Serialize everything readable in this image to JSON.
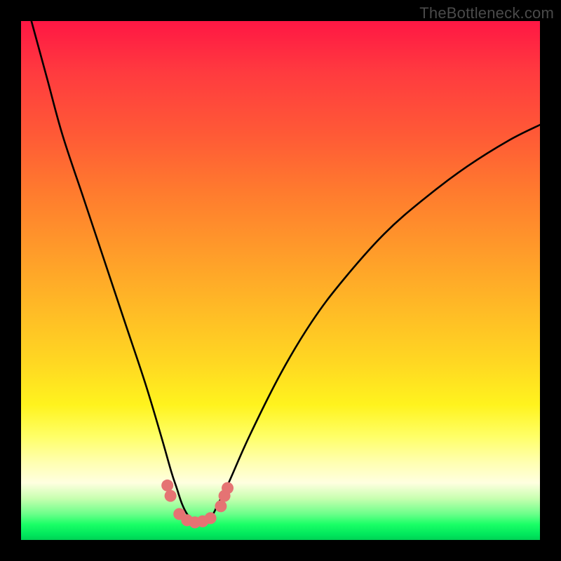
{
  "watermark": "TheBottleneck.com",
  "chart_data": {
    "type": "line",
    "title": "",
    "xlabel": "",
    "ylabel": "",
    "xlim": [
      0,
      100
    ],
    "ylim": [
      0,
      100
    ],
    "series": [
      {
        "name": "bottleneck-curve",
        "x": [
          2,
          5,
          8,
          12,
          16,
          20,
          24,
          27,
          29,
          30,
          31,
          32,
          33,
          34,
          35,
          36,
          37,
          38,
          40,
          44,
          50,
          56,
          62,
          70,
          78,
          86,
          94,
          100
        ],
        "y": [
          100,
          89,
          78,
          66,
          54,
          42,
          30,
          20,
          13,
          10,
          7,
          5,
          4,
          3.5,
          3.5,
          4,
          5,
          7,
          11,
          20,
          32,
          42,
          50,
          59,
          66,
          72,
          77,
          80
        ]
      }
    ],
    "markers": {
      "name": "highlight-dots",
      "color": "#e57373",
      "points": [
        {
          "x": 28.2,
          "y": 10.5
        },
        {
          "x": 28.8,
          "y": 8.5
        },
        {
          "x": 30.5,
          "y": 5.0
        },
        {
          "x": 32.0,
          "y": 3.8
        },
        {
          "x": 33.5,
          "y": 3.4
        },
        {
          "x": 35.0,
          "y": 3.6
        },
        {
          "x": 36.5,
          "y": 4.2
        },
        {
          "x": 38.5,
          "y": 6.5
        },
        {
          "x": 39.2,
          "y": 8.5
        },
        {
          "x": 39.8,
          "y": 10.0
        }
      ]
    }
  }
}
